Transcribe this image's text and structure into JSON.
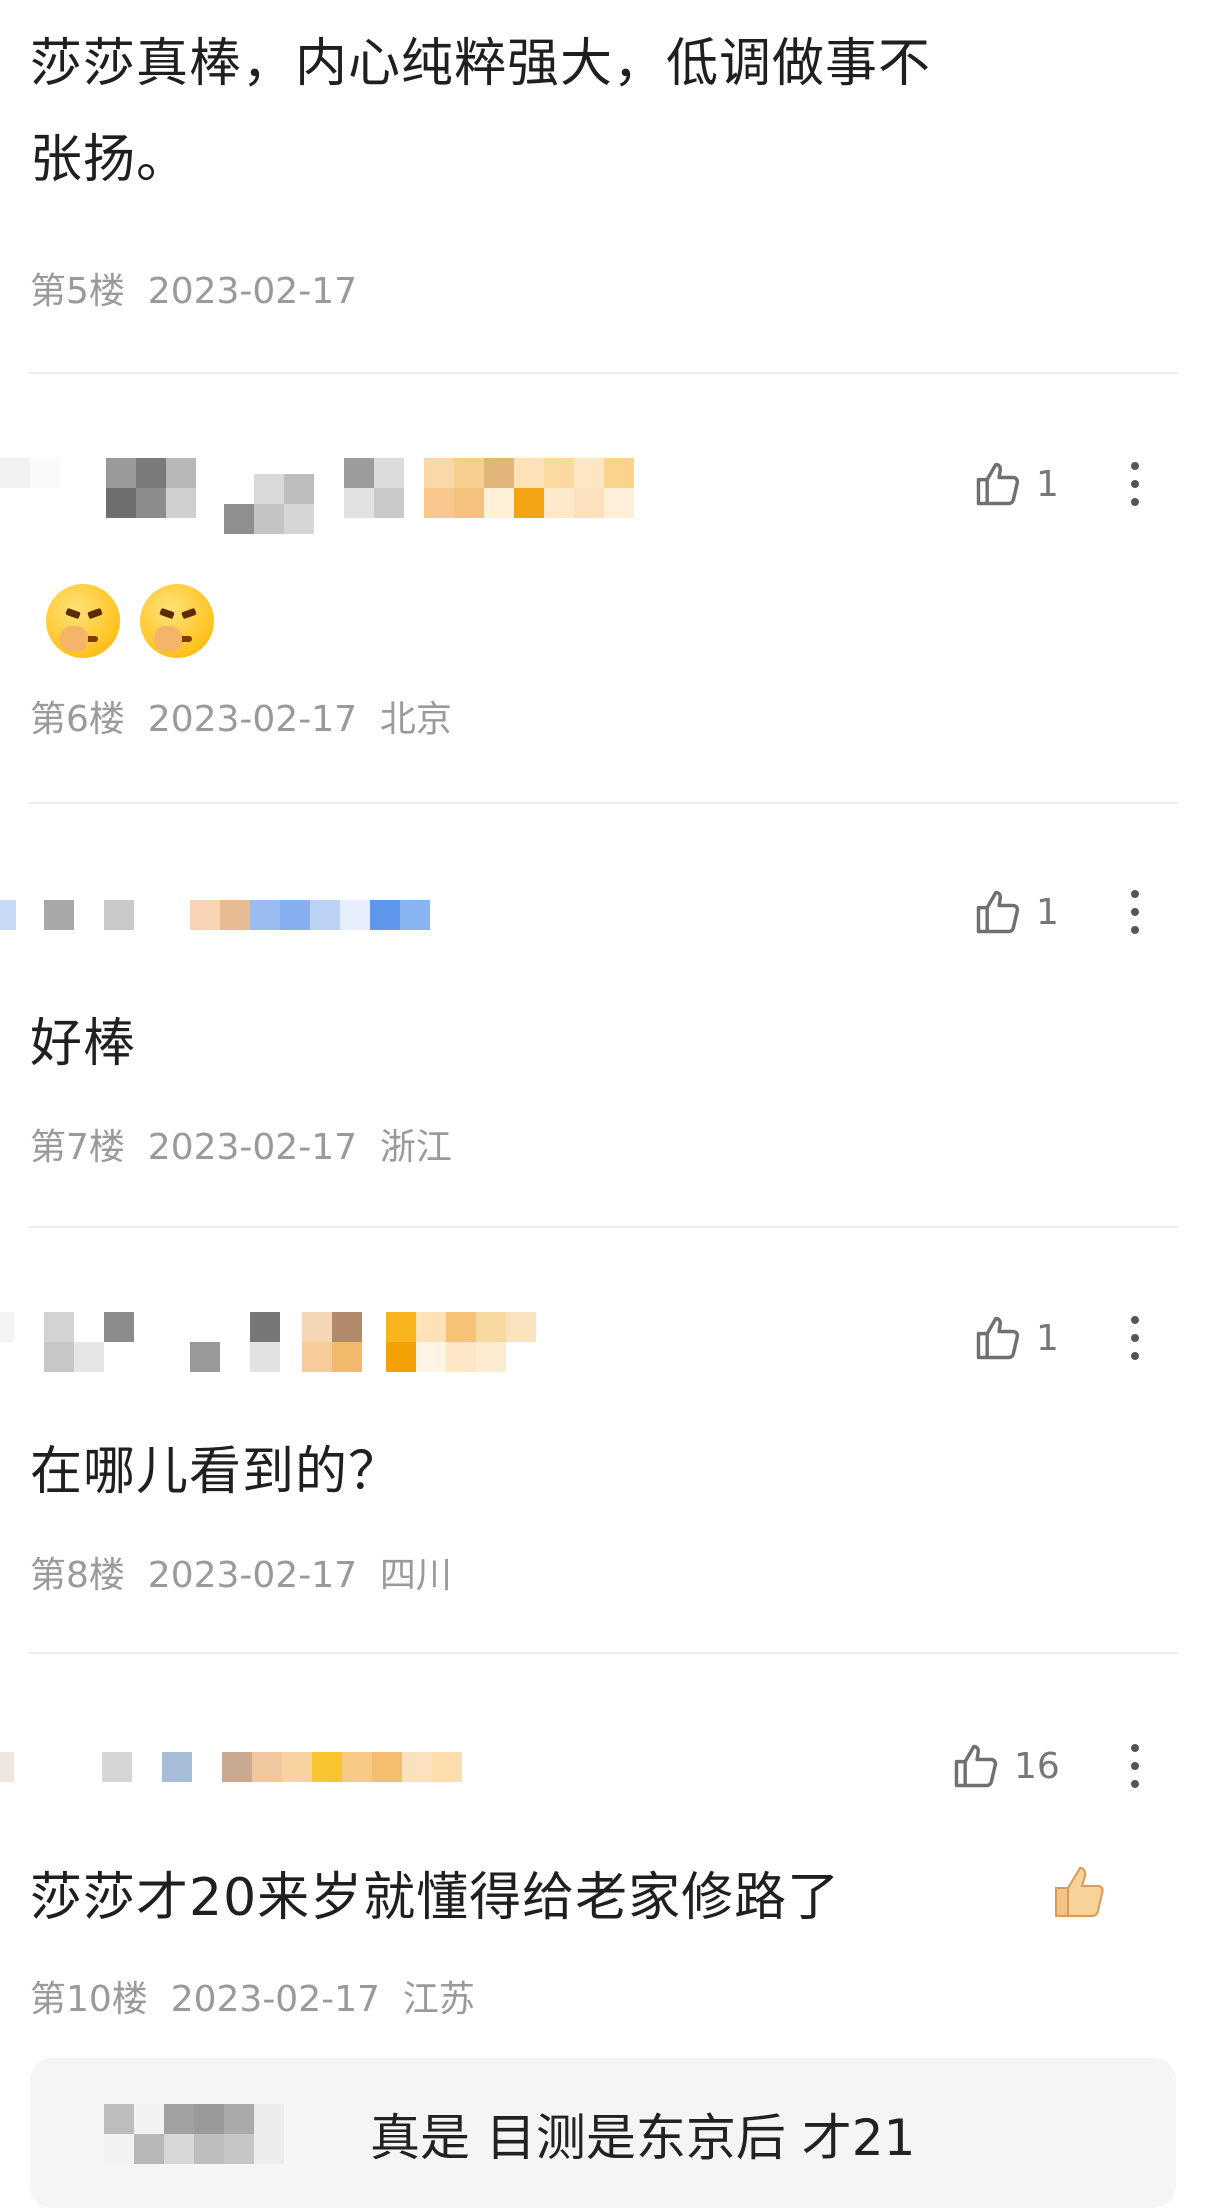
{
  "comments": [
    {
      "floor": "第5楼",
      "date": "2023-02-17",
      "location": "",
      "text_lines": [
        "莎莎真棒，内心纯粹强大，低调做事不",
        "张扬。"
      ]
    },
    {
      "floor": "第6楼",
      "date": "2023-02-17",
      "location": "北京",
      "likes": "1",
      "emoji": [
        "angry-face-emoji",
        "angry-face-emoji"
      ]
    },
    {
      "floor": "第7楼",
      "date": "2023-02-17",
      "location": "浙江",
      "likes": "1",
      "text": "好棒"
    },
    {
      "floor": "第8楼",
      "date": "2023-02-17",
      "location": "四川",
      "likes": "1",
      "text": "在哪儿看到的？"
    },
    {
      "floor": "第10楼",
      "date": "2023-02-17",
      "location": "江苏",
      "likes": "16",
      "text": "莎莎才20来岁就懂得给老家修路了",
      "trailing_emoji": "thumbs-up-emoji"
    }
  ],
  "reply": {
    "text": "真是 目测是东京后 才21"
  },
  "icons": {
    "like": "thumbs-up-icon",
    "more": "more-vertical-icon"
  },
  "colors": {
    "text": "#1f1f1f",
    "meta": "#9a9a9a",
    "divider": "#eeeeee",
    "reply_bg": "#f5f5f5"
  }
}
